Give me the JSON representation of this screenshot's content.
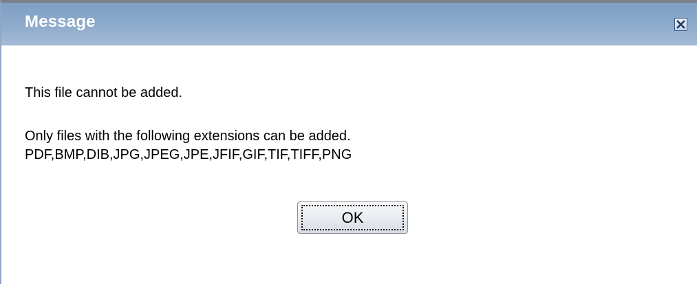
{
  "dialog": {
    "title": "Message",
    "close_icon": "close-x-icon",
    "message_line1": "This file cannot be added.",
    "message_line2": "Only files with the following extensions can be added.",
    "message_line3": "PDF,BMP,DIB,JPG,JPEG,JPE,JFIF,GIF,TIF,TIFF,PNG",
    "ok_label": "OK"
  },
  "colors": {
    "title_bar": "#8aa8c9",
    "title_text": "#ffffff",
    "close_button_border": "#3d5a86",
    "body_background": "#ffffff",
    "body_text": "#000000"
  }
}
